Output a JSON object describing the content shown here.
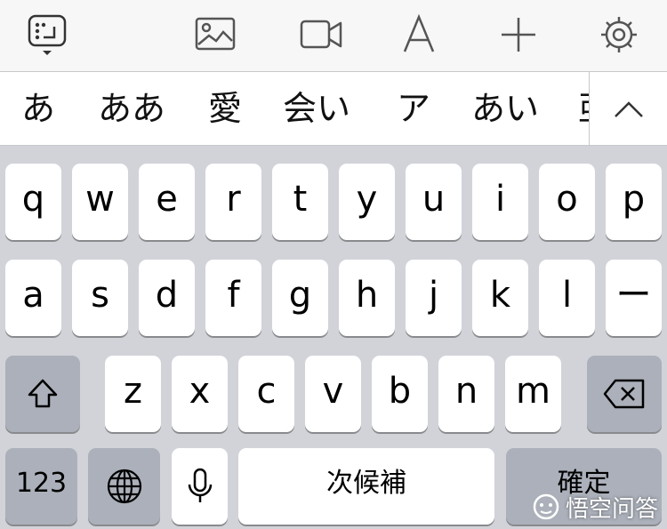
{
  "toolbar": {
    "icons": [
      "keyboard-settings-icon",
      "photo-icon",
      "video-icon",
      "text-format-icon",
      "add-icon",
      "settings-gear-icon"
    ]
  },
  "candidates": [
    "あ",
    "ああ",
    "愛",
    "会い",
    "ア",
    "あい",
    "亜"
  ],
  "rows": {
    "row1": [
      "q",
      "w",
      "e",
      "r",
      "t",
      "y",
      "u",
      "i",
      "o",
      "p"
    ],
    "row2": [
      "a",
      "s",
      "d",
      "f",
      "g",
      "h",
      "j",
      "k",
      "l",
      "ー"
    ],
    "row3": [
      "z",
      "x",
      "c",
      "v",
      "b",
      "n",
      "m"
    ]
  },
  "bottom": {
    "numbers_label": "123",
    "space_label": "次候補",
    "confirm_label": "確定"
  },
  "watermark": {
    "text": "悟空问答"
  },
  "colors": {
    "keyboard_bg": "#d1d3d9",
    "key_bg": "#ffffff",
    "function_key_bg": "#abb0ba",
    "toolbar_bg": "#f7f7f7"
  }
}
